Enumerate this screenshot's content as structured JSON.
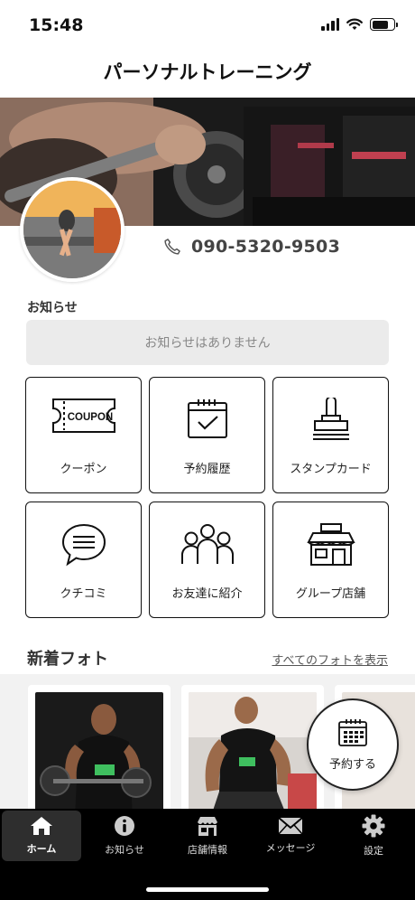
{
  "status_bar": {
    "time": "15:48"
  },
  "header": {
    "title": "パーソナルトレーニング"
  },
  "profile": {
    "phone": "090-5320-9503"
  },
  "notice": {
    "label": "お知らせ",
    "empty_text": "お知らせはありません"
  },
  "tiles": [
    {
      "label": "クーポン",
      "icon": "coupon-icon",
      "icon_text": "COUPON"
    },
    {
      "label": "予約履歴",
      "icon": "calendar-check-icon"
    },
    {
      "label": "スタンプカード",
      "icon": "stamp-icon"
    },
    {
      "label": "クチコミ",
      "icon": "speech-bubble-icon"
    },
    {
      "label": "お友達に紹介",
      "icon": "people-icon"
    },
    {
      "label": "グループ店舗",
      "icon": "store-icon"
    }
  ],
  "photos": {
    "title": "新着フォト",
    "see_all": "すべてのフォトを表示"
  },
  "reserve": {
    "label": "予約する",
    "icon": "calendar-icon"
  },
  "tabbar": {
    "items": [
      {
        "label": "ホーム",
        "icon": "home-icon",
        "active": true
      },
      {
        "label": "お知らせ",
        "icon": "info-icon",
        "active": false
      },
      {
        "label": "店舗情報",
        "icon": "shop-icon",
        "active": false
      },
      {
        "label": "メッセージ",
        "icon": "mail-icon",
        "active": false
      },
      {
        "label": "設定",
        "icon": "gear-icon",
        "active": false
      }
    ]
  },
  "colors": {
    "tabbar_bg": "#000000",
    "notice_bg": "#ebebeb",
    "accent_green": "#3fbf5f"
  }
}
